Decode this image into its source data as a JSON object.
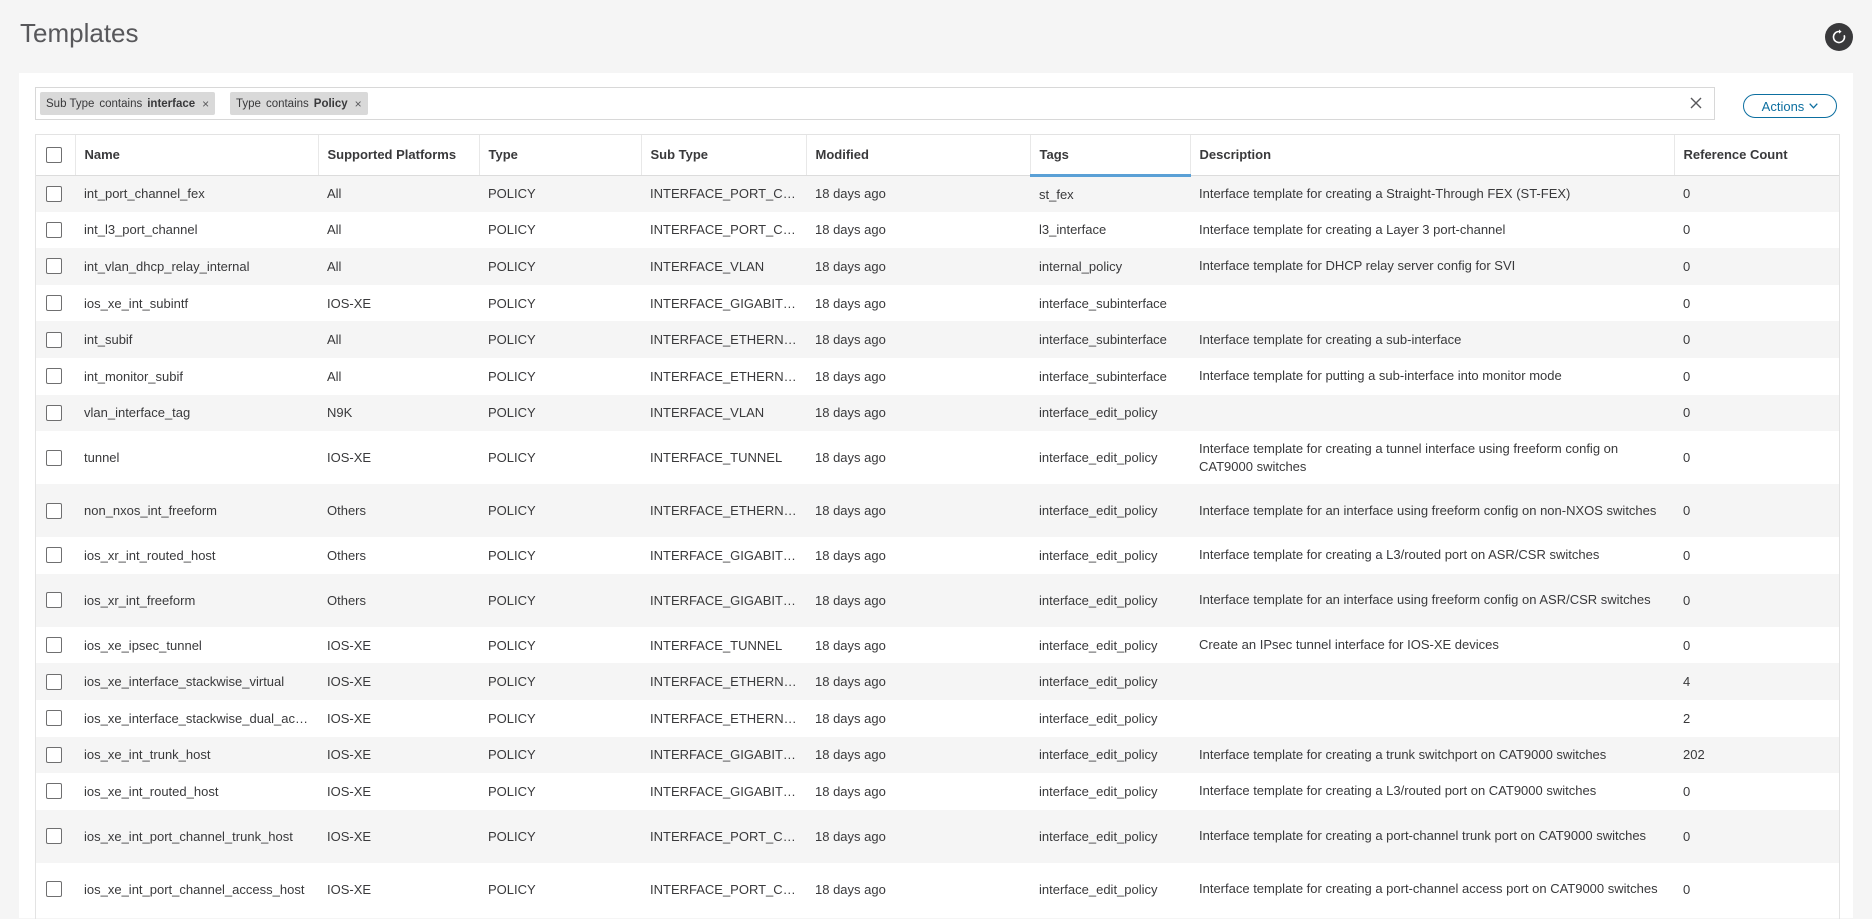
{
  "header": {
    "title": "Templates"
  },
  "filters": [
    {
      "field": "Sub Type",
      "op": "contains",
      "value": "interface"
    },
    {
      "field": "Type",
      "op": "contains",
      "value": "Policy"
    }
  ],
  "filter_remove_glyph": "×",
  "actions_label": "Actions",
  "columns": [
    "Name",
    "Supported Platforms",
    "Type",
    "Sub Type",
    "Modified",
    "Tags",
    "Description",
    "Reference Count"
  ],
  "sorted_column": "Tags",
  "rows": [
    {
      "name": "int_port_channel_fex",
      "platforms": "All",
      "type": "POLICY",
      "subtype": "INTERFACE_PORT_CH...",
      "modified": "18 days ago",
      "tags": "st_fex",
      "description": "Interface template for creating a Straight-Through FEX (ST-FEX)",
      "refcount": "0"
    },
    {
      "name": "int_l3_port_channel",
      "platforms": "All",
      "type": "POLICY",
      "subtype": "INTERFACE_PORT_CH...",
      "modified": "18 days ago",
      "tags": "l3_interface",
      "description": "Interface template for creating a Layer 3 port-channel",
      "refcount": "0"
    },
    {
      "name": "int_vlan_dhcp_relay_internal",
      "platforms": "All",
      "type": "POLICY",
      "subtype": "INTERFACE_VLAN",
      "modified": "18 days ago",
      "tags": "internal_policy",
      "description": "Interface template for DHCP relay server config for SVI",
      "refcount": "0"
    },
    {
      "name": "ios_xe_int_subintf",
      "platforms": "IOS-XE",
      "type": "POLICY",
      "subtype": "INTERFACE_GIGABITE...",
      "modified": "18 days ago",
      "tags": "interface_subinterface",
      "description": "",
      "refcount": "0"
    },
    {
      "name": "int_subif",
      "platforms": "All",
      "type": "POLICY",
      "subtype": "INTERFACE_ETHERNET",
      "modified": "18 days ago",
      "tags": "interface_subinterface",
      "description": "Interface template for creating a sub-interface",
      "refcount": "0"
    },
    {
      "name": "int_monitor_subif",
      "platforms": "All",
      "type": "POLICY",
      "subtype": "INTERFACE_ETHERNET",
      "modified": "18 days ago",
      "tags": "interface_subinterface",
      "description": "Interface template for putting a sub-interface into monitor mode",
      "refcount": "0"
    },
    {
      "name": "vlan_interface_tag",
      "platforms": "N9K",
      "type": "POLICY",
      "subtype": "INTERFACE_VLAN",
      "modified": "18 days ago",
      "tags": "interface_edit_policy",
      "description": "",
      "refcount": "0"
    },
    {
      "name": "tunnel",
      "platforms": "IOS-XE",
      "type": "POLICY",
      "subtype": "INTERFACE_TUNNEL",
      "modified": "18 days ago",
      "tags": "interface_edit_policy",
      "description": "Interface template for creating a tunnel interface using freeform config on CAT9000 switches",
      "refcount": "0",
      "tall": true
    },
    {
      "name": "non_nxos_int_freeform",
      "platforms": "Others",
      "type": "POLICY",
      "subtype": "INTERFACE_ETHERNET",
      "modified": "18 days ago",
      "tags": "interface_edit_policy",
      "description": "Interface template for an interface using freeform config on non-NXOS switches",
      "refcount": "0",
      "tall": true
    },
    {
      "name": "ios_xr_int_routed_host",
      "platforms": "Others",
      "type": "POLICY",
      "subtype": "INTERFACE_GIGABITE...",
      "modified": "18 days ago",
      "tags": "interface_edit_policy",
      "description": "Interface template for creating a L3/routed port on ASR/CSR switches",
      "refcount": "0"
    },
    {
      "name": "ios_xr_int_freeform",
      "platforms": "Others",
      "type": "POLICY",
      "subtype": "INTERFACE_GIGABITE...",
      "modified": "18 days ago",
      "tags": "interface_edit_policy",
      "description": "Interface template for an interface using freeform config on ASR/CSR switches",
      "refcount": "0",
      "tall": true
    },
    {
      "name": "ios_xe_ipsec_tunnel",
      "platforms": "IOS-XE",
      "type": "POLICY",
      "subtype": "INTERFACE_TUNNEL",
      "modified": "18 days ago",
      "tags": "interface_edit_policy",
      "description": "Create an IPsec tunnel interface for IOS-XE devices",
      "refcount": "0"
    },
    {
      "name": "ios_xe_interface_stackwise_virtual",
      "platforms": "IOS-XE",
      "type": "POLICY",
      "subtype": "INTERFACE_ETHERNET",
      "modified": "18 days ago",
      "tags": "interface_edit_policy",
      "description": "",
      "refcount": "4"
    },
    {
      "name": "ios_xe_interface_stackwise_dual_active",
      "platforms": "IOS-XE",
      "type": "POLICY",
      "subtype": "INTERFACE_ETHERNET",
      "modified": "18 days ago",
      "tags": "interface_edit_policy",
      "description": "",
      "refcount": "2"
    },
    {
      "name": "ios_xe_int_trunk_host",
      "platforms": "IOS-XE",
      "type": "POLICY",
      "subtype": "INTERFACE_GIGABITE...",
      "modified": "18 days ago",
      "tags": "interface_edit_policy",
      "description": "Interface template for creating a trunk switchport on CAT9000 switches",
      "refcount": "202"
    },
    {
      "name": "ios_xe_int_routed_host",
      "platforms": "IOS-XE",
      "type": "POLICY",
      "subtype": "INTERFACE_GIGABITE...",
      "modified": "18 days ago",
      "tags": "interface_edit_policy",
      "description": "Interface template for creating a L3/routed port on CAT9000 switches",
      "refcount": "0"
    },
    {
      "name": "ios_xe_int_port_channel_trunk_host",
      "platforms": "IOS-XE",
      "type": "POLICY",
      "subtype": "INTERFACE_PORT_CH...",
      "modified": "18 days ago",
      "tags": "interface_edit_policy",
      "description": "Interface template for creating a port-channel trunk port on CAT9000 switches",
      "refcount": "0",
      "tall": true
    },
    {
      "name": "ios_xe_int_port_channel_access_host",
      "platforms": "IOS-XE",
      "type": "POLICY",
      "subtype": "INTERFACE_PORT_CH...",
      "modified": "18 days ago",
      "tags": "interface_edit_policy",
      "description": "Interface template for creating a port-channel access port on CAT9000 switches",
      "refcount": "0",
      "tall": true
    }
  ],
  "icons": {
    "refresh": "refresh-icon",
    "clear": "close-icon",
    "chevron": "chevron-down-icon"
  }
}
